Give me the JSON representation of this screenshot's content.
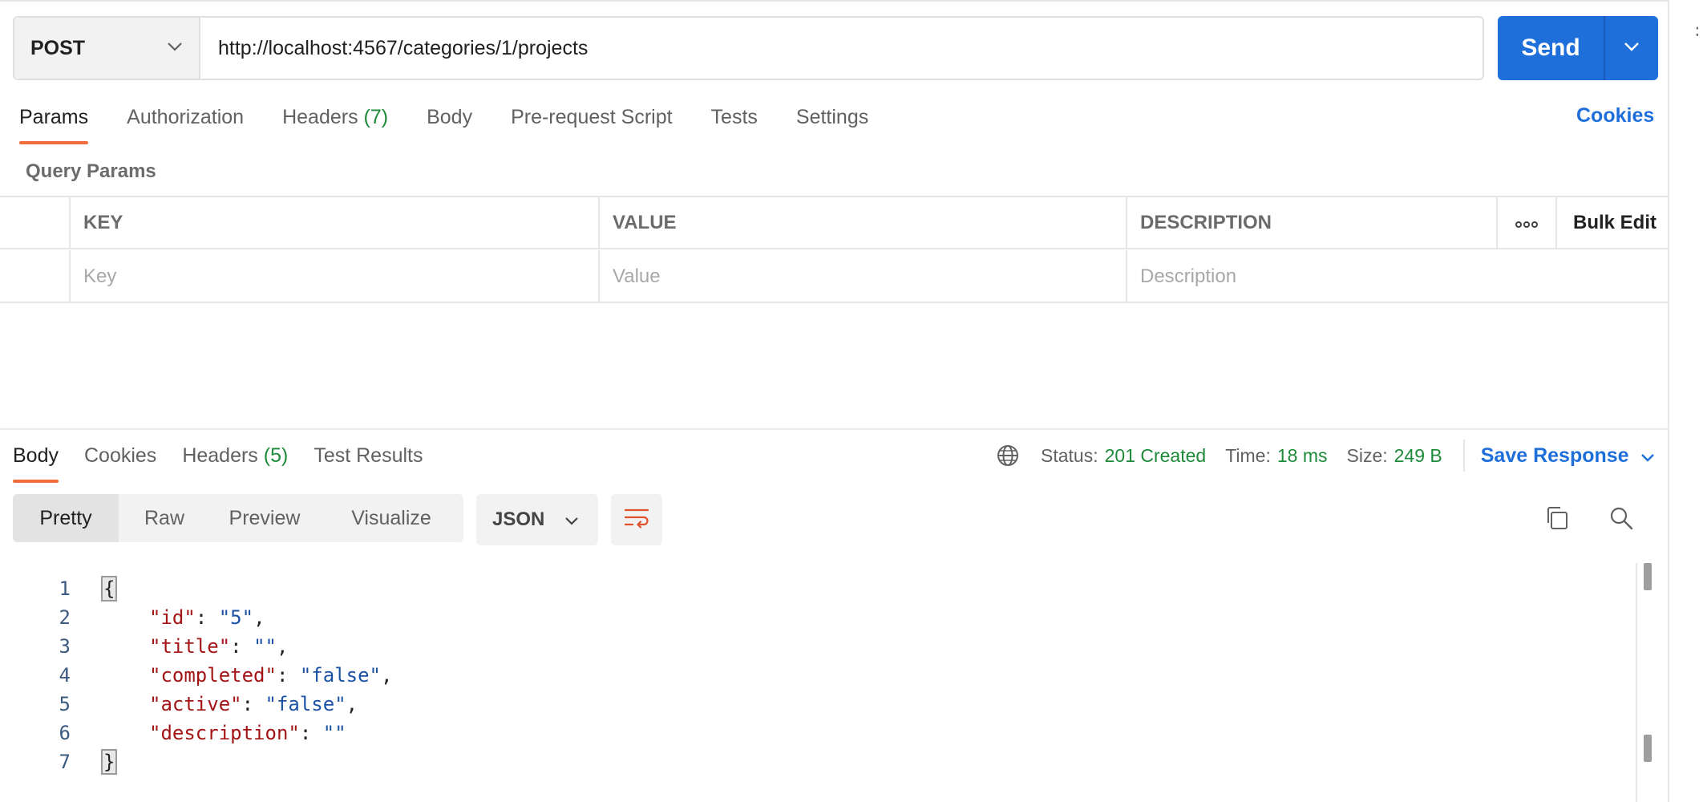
{
  "request": {
    "method": "POST",
    "url": "http://localhost:4567/categories/1/projects",
    "send_label": "Send"
  },
  "request_tabs": {
    "params": "Params",
    "authorization": "Authorization",
    "headers": "Headers",
    "headers_count": "(7)",
    "body": "Body",
    "pre_request": "Pre-request Script",
    "tests": "Tests",
    "settings": "Settings",
    "cookies": "Cookies"
  },
  "query_params": {
    "title": "Query Params",
    "columns": {
      "key": "KEY",
      "value": "VALUE",
      "description": "DESCRIPTION"
    },
    "bulk_edit": "Bulk Edit",
    "placeholders": {
      "key": "Key",
      "value": "Value",
      "description": "Description"
    }
  },
  "response_tabs": {
    "body": "Body",
    "cookies": "Cookies",
    "headers": "Headers",
    "headers_count": "(5)",
    "test_results": "Test Results"
  },
  "response_status": {
    "status_label": "Status:",
    "status_value": "201 Created",
    "time_label": "Time:",
    "time_value": "18 ms",
    "size_label": "Size:",
    "size_value": "249 B",
    "save_response": "Save Response"
  },
  "view_modes": {
    "pretty": "Pretty",
    "raw": "Raw",
    "preview": "Preview",
    "visualize": "Visualize",
    "format": "JSON"
  },
  "code": {
    "line_numbers": [
      "1",
      "2",
      "3",
      "4",
      "5",
      "6",
      "7"
    ],
    "open_brace": "{",
    "close_brace": "}",
    "entries": [
      {
        "key": "\"id\"",
        "value": "\"5\"",
        "comma": ","
      },
      {
        "key": "\"title\"",
        "value": "\"\"",
        "comma": ","
      },
      {
        "key": "\"completed\"",
        "value": "\"false\"",
        "comma": ","
      },
      {
        "key": "\"active\"",
        "value": "\"false\"",
        "comma": ","
      },
      {
        "key": "\"description\"",
        "value": "\"\"",
        "comma": ""
      }
    ]
  },
  "colors": {
    "accent_blue": "#1f6fdb",
    "tab_underline": "#ef6c3d",
    "status_green": "#1f8a3a",
    "json_key": "#a31515",
    "json_string": "#1c52a6"
  },
  "gutter_glyph": "∶"
}
